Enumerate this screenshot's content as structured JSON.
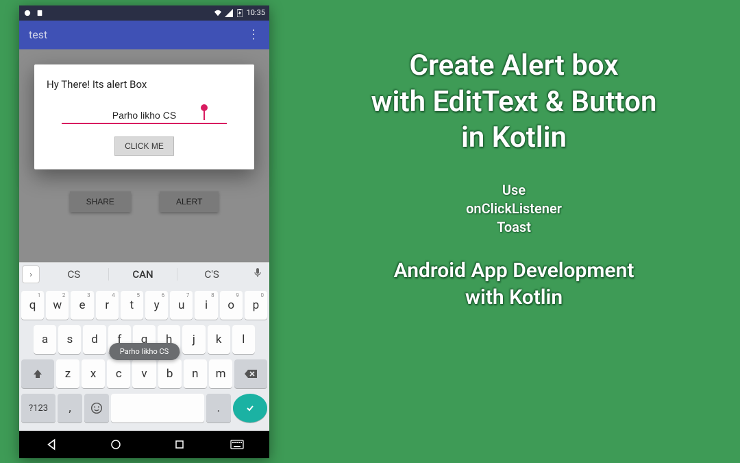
{
  "statusbar": {
    "time": "10:35"
  },
  "appbar": {
    "title": "test"
  },
  "dialog": {
    "title": "Hy There!  Its alert Box",
    "input_value": "Parho likho CS",
    "button_label": "CLICK ME"
  },
  "main_buttons": {
    "share": "SHARE",
    "alert": "ALERT"
  },
  "suggestions": {
    "s1": "CS",
    "s2": "CAN",
    "s3": "C'S"
  },
  "keys": {
    "row1": [
      "q",
      "w",
      "e",
      "r",
      "t",
      "y",
      "u",
      "i",
      "o",
      "p"
    ],
    "row1_sup": [
      "1",
      "2",
      "3",
      "4",
      "5",
      "6",
      "7",
      "8",
      "9",
      "0"
    ],
    "row2": [
      "a",
      "s",
      "d",
      "f",
      "g",
      "h",
      "j",
      "k",
      "l"
    ],
    "row3": [
      "z",
      "x",
      "c",
      "v",
      "b",
      "n",
      "m"
    ],
    "sym": "?123",
    "comma": ",",
    "dot": "."
  },
  "toast": "Parho likho CS",
  "promo": {
    "headline_l1": "Create Alert box",
    "headline_l2": "with EditText & Button",
    "headline_l3": "in Kotlin",
    "sub_l1": "Use",
    "sub_l2": "onClickListener",
    "sub_l3": "Toast",
    "course_l1": "Android App Development",
    "course_l2": "with Kotlin"
  }
}
